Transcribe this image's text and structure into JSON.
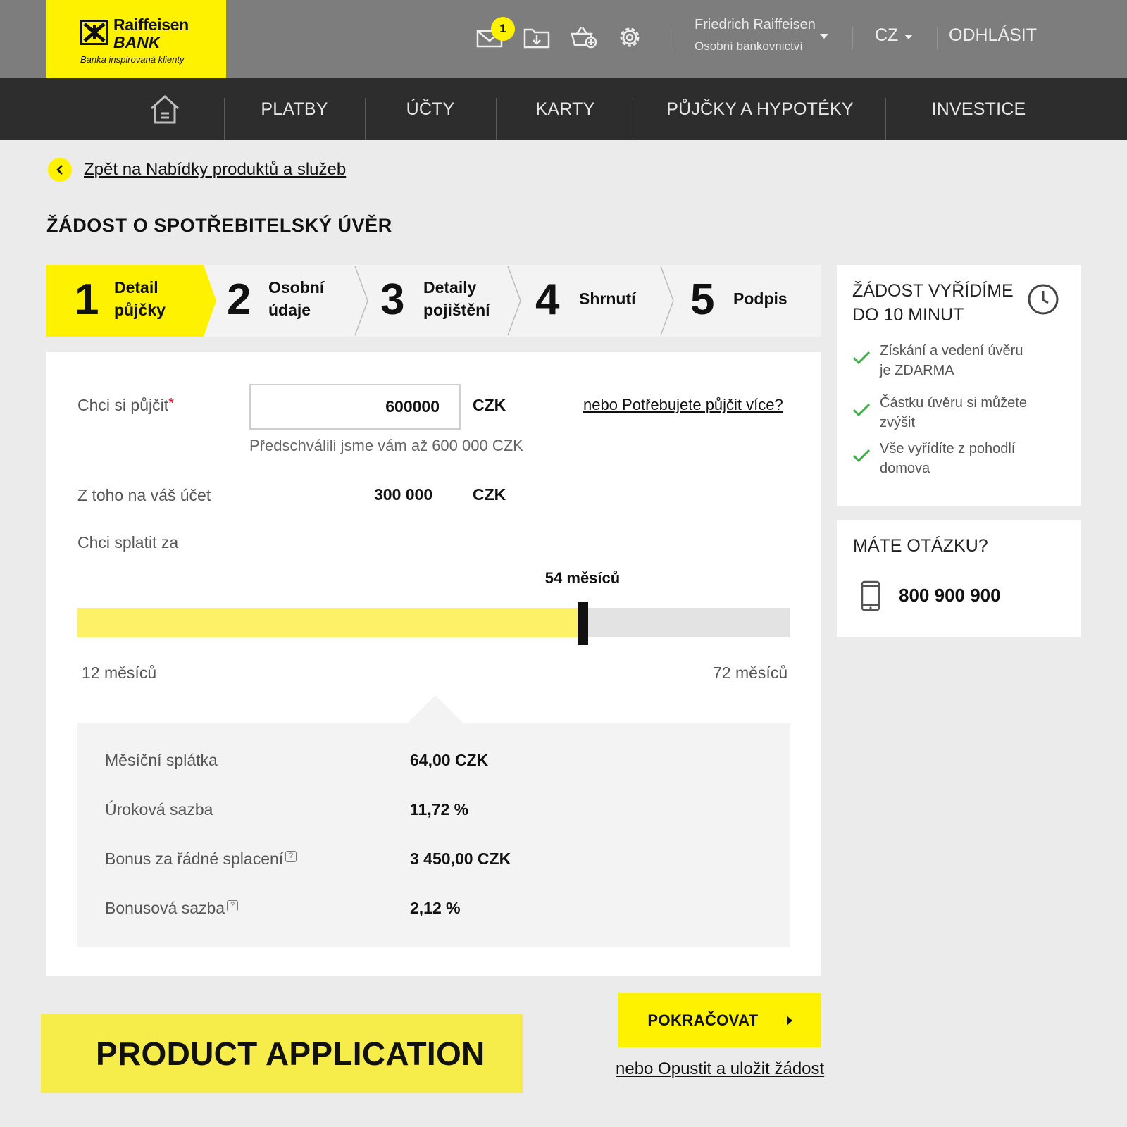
{
  "brand": {
    "name_line1": "Raiffeisen",
    "name_line2": "BANK",
    "slogan": "Banka inspirovaná klienty",
    "accent_color": "#fff200"
  },
  "header": {
    "icons": [
      "mail-icon",
      "download-icon",
      "basket-add-icon",
      "gear-icon"
    ],
    "mail_badge_count": "1",
    "user_name": "Friedrich Raiffeisen",
    "user_segment": "Osobní bankovnictví",
    "language": "CZ",
    "logout_label": "ODHLÁSIT"
  },
  "nav": {
    "home_icon": "home-icon",
    "items": [
      {
        "label": "PLATBY"
      },
      {
        "label": "ÚČTY"
      },
      {
        "label": "KARTY"
      },
      {
        "label": "PŮJČKY A HYPOTÉKY"
      },
      {
        "label": "INVESTICE"
      }
    ]
  },
  "back_link": "Zpět na Nabídky produktů a služeb",
  "page_title": "ŽÁDOST O SPOTŘEBITELSKÝ ÚVĚR",
  "steps": [
    {
      "number": "1",
      "line1": "Detail",
      "line2": "půjčky",
      "active": true
    },
    {
      "number": "2",
      "line1": "Osobní",
      "line2": "údaje",
      "active": false
    },
    {
      "number": "3",
      "line1": "Detaily",
      "line2": "pojištění",
      "active": false
    },
    {
      "number": "4",
      "line1": "Shrnutí",
      "line2": "",
      "active": false
    },
    {
      "number": "5",
      "line1": "Podpis",
      "line2": "",
      "active": false
    }
  ],
  "form": {
    "borrow_label": "Chci si půjčit",
    "required_mark": "*",
    "amount_value": "600000",
    "currency": "CZK",
    "more_link": "nebo Potřebujete půjčit více?",
    "preapproved_hint": "Předschválili jsme vám až 600 000 CZK",
    "to_account_label": "Z toho na váš účet",
    "to_account_value": "300 000",
    "repay_label": "Chci splatit za",
    "slider": {
      "value_label": "54 měsíců",
      "min_label": "12 měsíců",
      "max_label": "72 měsíců",
      "min": 12,
      "max": 72,
      "value": 54.5
    }
  },
  "summary": {
    "rows": [
      {
        "label": "Měsíční splátka",
        "value": "64,00 CZK",
        "help": false
      },
      {
        "label": "Úroková sazba",
        "value": "11,72 %",
        "help": false
      },
      {
        "label": "Bonus za řádné splacení",
        "value": "3 450,00 CZK",
        "help": true
      },
      {
        "label": "Bonusová sazba",
        "value": "2,12 %",
        "help": true
      }
    ]
  },
  "side_info": {
    "title_line1": "ŽÁDOST VYŘÍDÍME",
    "title_line2": "DO 10 MINUT",
    "benefits": [
      {
        "line1": "Získání a vedení úvěru",
        "line2": "je ZDARMA"
      },
      {
        "line1": "Částku úvěru si můžete",
        "line2": "zvýšit"
      },
      {
        "line1": "Vše vyřídíte z pohodlí",
        "line2": "domova"
      }
    ]
  },
  "contact": {
    "title": "MÁTE OTÁZKU?",
    "phone": "800 900 900"
  },
  "actions": {
    "continue_label": "POKRAČOVAT",
    "leave_link": "nebo Opustit a uložit žádost"
  },
  "banner_text": "PRODUCT APPLICATION"
}
